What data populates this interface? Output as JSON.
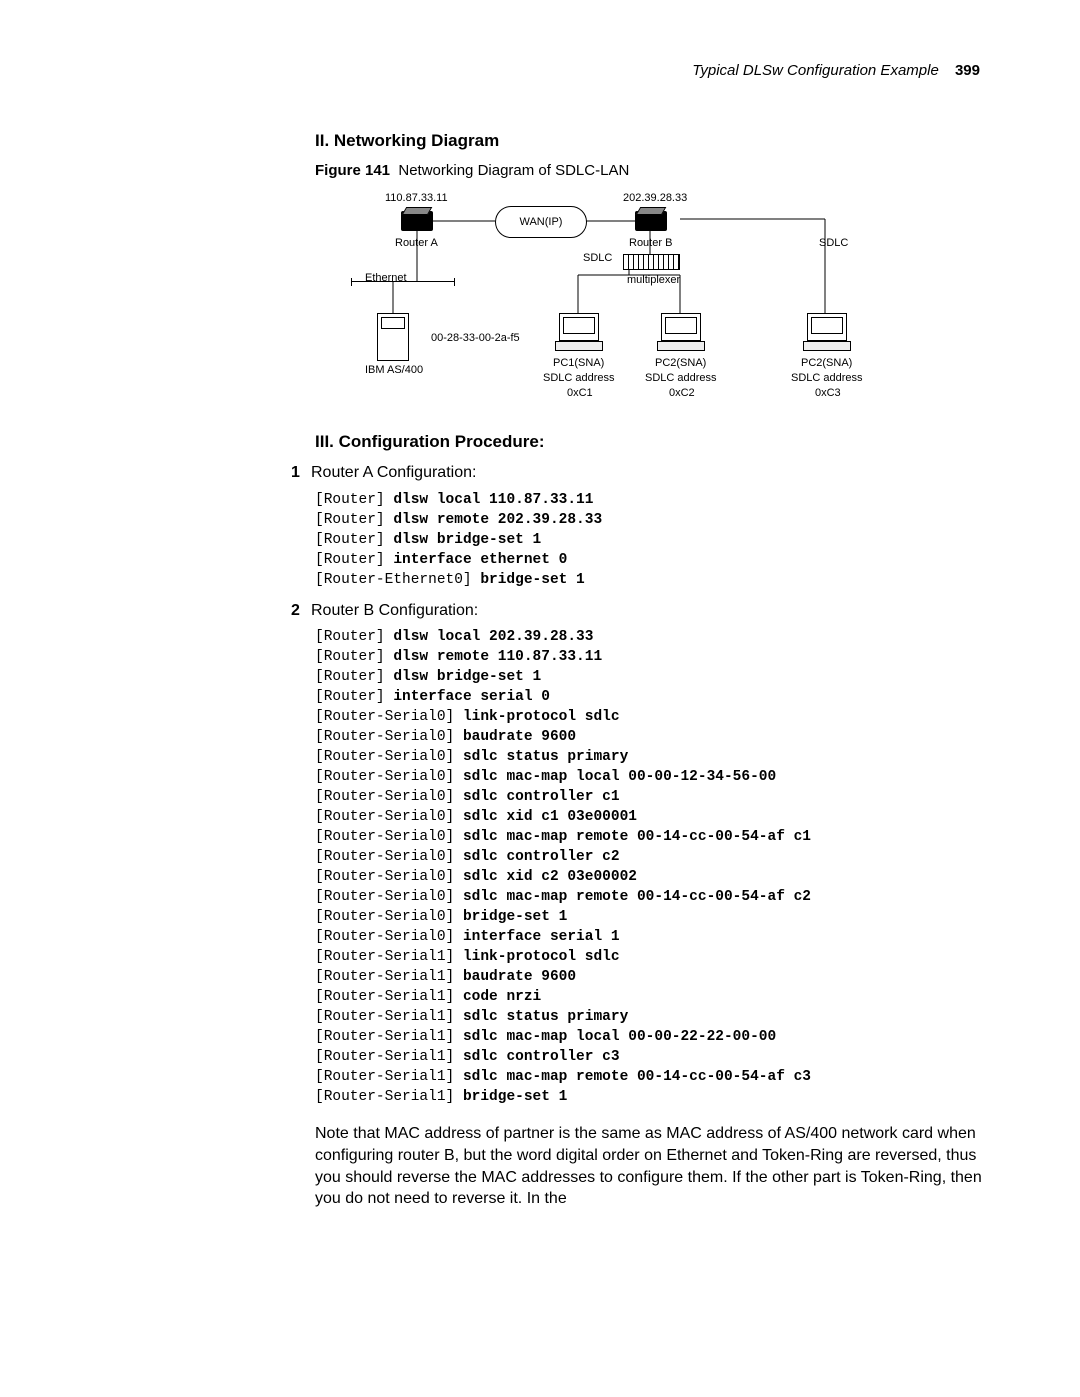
{
  "header": {
    "running_title": "Typical DLSw Configuration Example",
    "page_number": "399"
  },
  "section_net_diag": {
    "heading": "II. Networking Diagram",
    "figure_label": "Figure 141",
    "figure_caption": "Networking Diagram of SDLC-LAN"
  },
  "diagram": {
    "ip_a": "110.87.33.11",
    "ip_b": "202.39.28.33",
    "router_a": "Router A",
    "router_b": "Router B",
    "wan": "WAN(IP)",
    "sdlc": "SDLC",
    "ethernet": "Ethernet",
    "multiplexer": "multiplexer",
    "mac_as400": "00-28-33-00-2a-f5",
    "ibm_as400": "IBM AS/400",
    "pc1": "PC1(SNA)",
    "pc2": "PC2(SNA)",
    "pc3": "PC2(SNA)",
    "addr1a": "SDLC address",
    "addr1b": "0xC1",
    "addr2a": "SDLC address",
    "addr2b": "0xC2",
    "addr3a": "SDLC address",
    "addr3b": "0xC3"
  },
  "section_config": {
    "heading": "III. Configuration Procedure:",
    "step1": {
      "num": "1",
      "title": "Router A Configuration:",
      "lines": [
        {
          "prompt": "[Router] ",
          "cmd": "dlsw local 110.87.33.11"
        },
        {
          "prompt": "[Router] ",
          "cmd": "dlsw remote 202.39.28.33"
        },
        {
          "prompt": "[Router] ",
          "cmd": "dlsw bridge-set 1"
        },
        {
          "prompt": "[Router] ",
          "cmd": "interface ethernet 0"
        },
        {
          "prompt": "[Router-Ethernet0] ",
          "cmd": "bridge-set 1"
        }
      ]
    },
    "step2": {
      "num": "2",
      "title": "Router B Configuration:",
      "lines": [
        {
          "prompt": "[Router] ",
          "cmd": "dlsw local 202.39.28.33"
        },
        {
          "prompt": "[Router] ",
          "cmd": "dlsw remote 110.87.33.11"
        },
        {
          "prompt": "[Router] ",
          "cmd": "dlsw bridge-set 1"
        },
        {
          "prompt": "[Router] ",
          "cmd": "interface serial 0"
        },
        {
          "prompt": "[Router-Serial0] ",
          "cmd": "link-protocol sdlc"
        },
        {
          "prompt": "[Router-Serial0] ",
          "cmd": "baudrate 9600"
        },
        {
          "prompt": "[Router-Serial0] ",
          "cmd": "sdlc status primary"
        },
        {
          "prompt": "[Router-Serial0] ",
          "cmd": "sdlc mac-map local 00-00-12-34-56-00"
        },
        {
          "prompt": "[Router-Serial0] ",
          "cmd": "sdlc controller c1"
        },
        {
          "prompt": "[Router-Serial0] ",
          "cmd": "sdlc xid c1 03e00001"
        },
        {
          "prompt": "[Router-Serial0] ",
          "cmd": "sdlc mac-map remote 00-14-cc-00-54-af c1"
        },
        {
          "prompt": "[Router-Serial0] ",
          "cmd": "sdlc controller c2"
        },
        {
          "prompt": "[Router-Serial0] ",
          "cmd": "sdlc xid c2 03e00002"
        },
        {
          "prompt": "[Router-Serial0] ",
          "cmd": "sdlc mac-map remote 00-14-cc-00-54-af c2"
        },
        {
          "prompt": "[Router-Serial0] ",
          "cmd": "bridge-set 1"
        },
        {
          "prompt": "[Router-Serial0] ",
          "cmd": "interface serial 1"
        },
        {
          "prompt": "[Router-Serial1] ",
          "cmd": "link-protocol sdlc"
        },
        {
          "prompt": "[Router-Serial1] ",
          "cmd": "baudrate 9600"
        },
        {
          "prompt": "[Router-Serial1] ",
          "cmd": "code nrzi"
        },
        {
          "prompt": "[Router-Serial1] ",
          "cmd": "sdlc status primary"
        },
        {
          "prompt": "[Router-Serial1] ",
          "cmd": "sdlc mac-map local 00-00-22-22-00-00"
        },
        {
          "prompt": "[Router-Serial1] ",
          "cmd": "sdlc controller c3"
        },
        {
          "prompt": "[Router-Serial1] ",
          "cmd": "sdlc mac-map remote 00-14-cc-00-54-af c3"
        },
        {
          "prompt": "[Router-Serial1] ",
          "cmd": "bridge-set 1"
        }
      ]
    },
    "note_text": "Note that MAC address of partner is the same as MAC address of AS/400 network card when configuring router B, but the word digital order on Ethernet and Token-Ring are reversed, thus you should reverse the MAC addresses to configure them. If the other part is Token-Ring, then you do not need to reverse it. In the"
  }
}
